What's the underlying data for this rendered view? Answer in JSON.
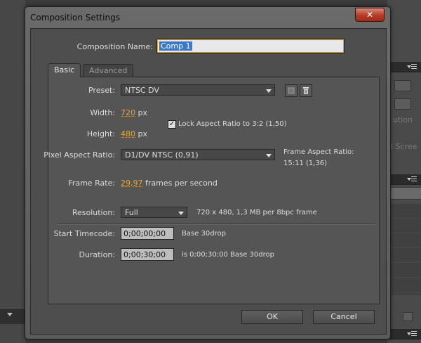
{
  "dialog": {
    "title": "Composition Settings",
    "close_label": "✕"
  },
  "composition_name": {
    "label": "Composition Name:",
    "value": "Comp 1"
  },
  "tabs": [
    {
      "label": "Basic",
      "active": true
    },
    {
      "label": "Advanced",
      "active": false
    }
  ],
  "preset": {
    "label": "Preset:",
    "value": "NTSC DV",
    "icons": [
      "save-preset-icon",
      "trash-icon"
    ]
  },
  "width": {
    "label": "Width:",
    "value": "720",
    "unit": "px"
  },
  "height": {
    "label": "Height:",
    "value": "480",
    "unit": "px"
  },
  "lock_aspect": {
    "label": "Lock Aspect Ratio to 3:2 (1,50)",
    "checked": true
  },
  "pixel_aspect": {
    "label": "Pixel Aspect Ratio:",
    "value": "D1/DV NTSC (0,91)",
    "frame_aspect_label": "Frame Aspect Ratio:",
    "frame_aspect_value": "15:11 (1,36)"
  },
  "frame_rate": {
    "label": "Frame Rate:",
    "value": "29,97",
    "unit": "frames per second"
  },
  "resolution": {
    "label": "Resolution:",
    "value": "Full",
    "info": "720 x 480, 1,3 MB per 8bpc frame"
  },
  "start_timecode": {
    "label": "Start Timecode:",
    "value": "0;00;00;00",
    "info": "Base 30drop"
  },
  "duration": {
    "label": "Duration:",
    "value": "0;00;30;00",
    "info": "is 0;00;30;00  Base 30drop"
  },
  "buttons": {
    "ok": "OK",
    "cancel": "Cancel"
  },
  "background": {
    "partial_text_1": "ution",
    "partial_text_2": "ll Scree"
  },
  "colors": {
    "accent_orange": "#e5a637",
    "selection_blue": "#3a79c9",
    "close_red": "#b83a25"
  }
}
